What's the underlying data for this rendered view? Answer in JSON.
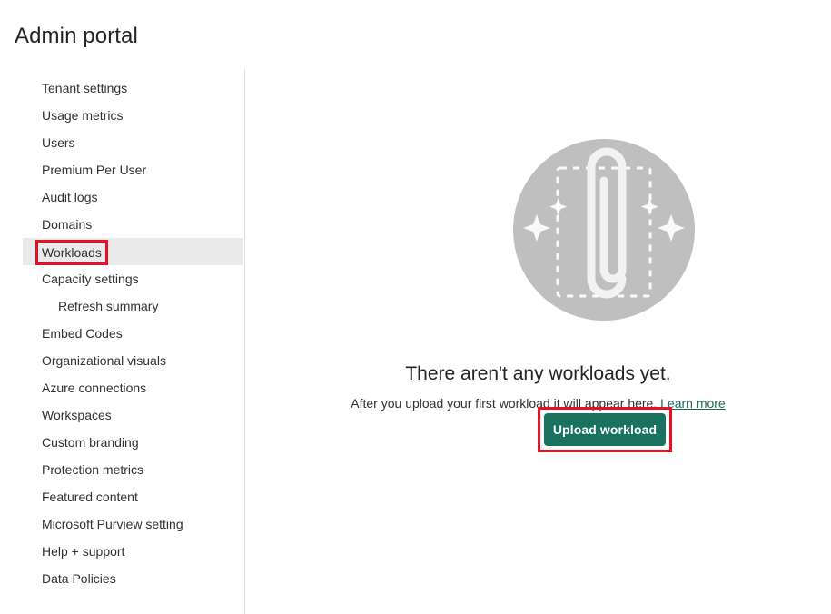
{
  "header": {
    "title": "Admin portal"
  },
  "sidebar": {
    "items": [
      {
        "label": "Tenant settings",
        "indent": false,
        "selected": false
      },
      {
        "label": "Usage metrics",
        "indent": false,
        "selected": false
      },
      {
        "label": "Users",
        "indent": false,
        "selected": false
      },
      {
        "label": "Premium Per User",
        "indent": false,
        "selected": false
      },
      {
        "label": "Audit logs",
        "indent": false,
        "selected": false
      },
      {
        "label": "Domains",
        "indent": false,
        "selected": false
      },
      {
        "label": "Workloads",
        "indent": false,
        "selected": true
      },
      {
        "label": "Capacity settings",
        "indent": false,
        "selected": false
      },
      {
        "label": "Refresh summary",
        "indent": true,
        "selected": false
      },
      {
        "label": "Embed Codes",
        "indent": false,
        "selected": false
      },
      {
        "label": "Organizational visuals",
        "indent": false,
        "selected": false
      },
      {
        "label": "Azure connections",
        "indent": false,
        "selected": false
      },
      {
        "label": "Workspaces",
        "indent": false,
        "selected": false
      },
      {
        "label": "Custom branding",
        "indent": false,
        "selected": false
      },
      {
        "label": "Protection metrics",
        "indent": false,
        "selected": false
      },
      {
        "label": "Featured content",
        "indent": false,
        "selected": false
      },
      {
        "label": "Microsoft Purview setting",
        "indent": false,
        "selected": false
      },
      {
        "label": "Help + support",
        "indent": false,
        "selected": false
      },
      {
        "label": "Data Policies",
        "indent": false,
        "selected": false
      }
    ]
  },
  "main": {
    "empty_state": {
      "illustration_name": "paperclip-upload-illustration",
      "title": "There aren't any workloads yet.",
      "description": "After you upload your first workload it will appear here.",
      "learn_more_label": "Learn more",
      "upload_button_label": "Upload workload"
    }
  },
  "colors": {
    "accent_button": "#19715f",
    "annotation": "#e81123",
    "link": "#1a6b5b",
    "selected_row": "#eaeaea",
    "illustration_circle": "#bfbfbf",
    "divider": "#e1dfdd"
  }
}
